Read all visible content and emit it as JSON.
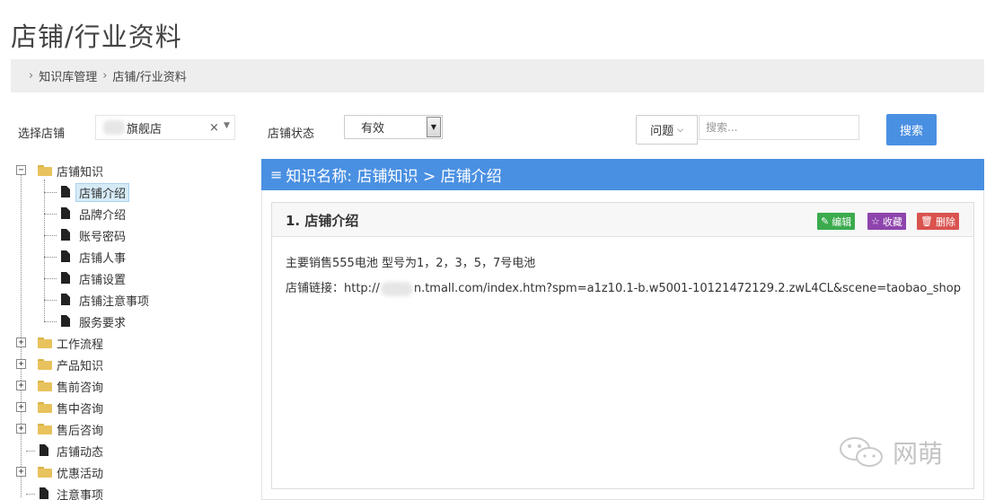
{
  "page_title": "店铺/行业资料",
  "breadcrumb": {
    "items": [
      "知识库管理",
      "店铺/行业资料"
    ]
  },
  "filters": {
    "store_label": "选择店铺",
    "store_value": "旗舰店",
    "store_clear": "×",
    "status_label": "店铺状态",
    "status_value": "有效",
    "question_type": "问题",
    "search_placeholder": "搜索...",
    "search_button": "搜索"
  },
  "tree": {
    "nodes": [
      {
        "label": "店铺知识",
        "type": "folder",
        "expanded": true
      },
      {
        "label": "店铺介绍",
        "type": "file",
        "selected": true
      },
      {
        "label": "品牌介绍",
        "type": "file"
      },
      {
        "label": "账号密码",
        "type": "file"
      },
      {
        "label": "店铺人事",
        "type": "file"
      },
      {
        "label": "店铺设置",
        "type": "file"
      },
      {
        "label": "店铺注意事项",
        "type": "file"
      },
      {
        "label": "服务要求",
        "type": "file"
      },
      {
        "label": "工作流程",
        "type": "folder"
      },
      {
        "label": "产品知识",
        "type": "folder"
      },
      {
        "label": "售前咨询",
        "type": "folder"
      },
      {
        "label": "售中咨询",
        "type": "folder"
      },
      {
        "label": "售后咨询",
        "type": "folder"
      },
      {
        "label": "店铺动态",
        "type": "file"
      },
      {
        "label": "优惠活动",
        "type": "folder"
      },
      {
        "label": "注意事项",
        "type": "file"
      }
    ]
  },
  "panel": {
    "header": "知识名称: 店铺知识 > 店铺介绍",
    "card_title": "1. 店铺介绍",
    "edit_label": "编辑",
    "fav_label": "收藏",
    "delete_label": "删除",
    "line1": "主要销售555电池 型号为1，2，3，5，7号电池",
    "line2_prefix": "店铺链接：http://",
    "line2_suffix": "n.tmall.com/index.htm?spm=a1z10.1-b.w5001-10121472129.2.zwL4CL&scene=taobao_shop"
  },
  "watermark": {
    "text": "网萌",
    "icon": "wechat-icon"
  },
  "colors": {
    "accent": "#4a90e2",
    "edit": "#3bab4d",
    "fav": "#8e44ad",
    "delete": "#d9534f"
  }
}
